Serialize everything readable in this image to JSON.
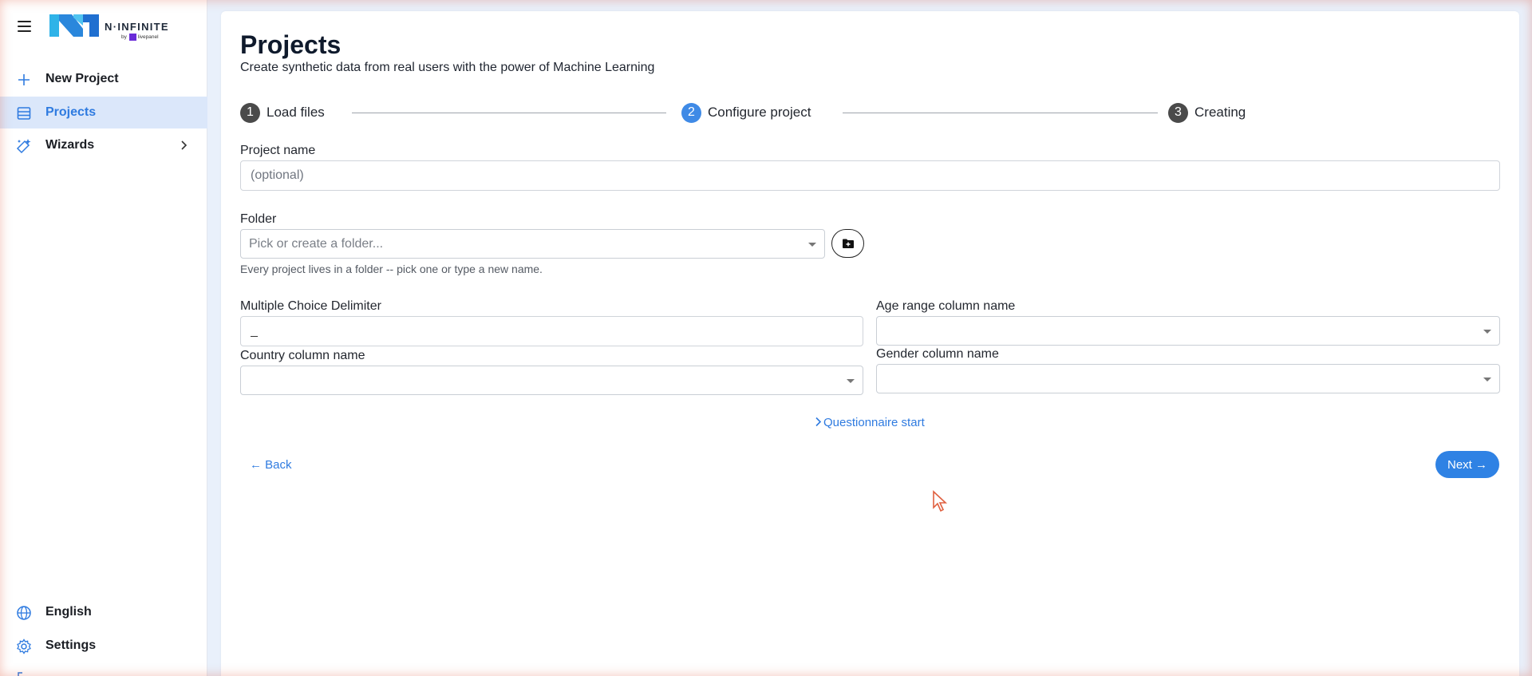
{
  "brand": {
    "name": "N·INFINITE",
    "by": "by",
    "partner": "livepanel"
  },
  "sidebar": {
    "items": [
      {
        "label": "New Project",
        "icon": "plus-icon"
      },
      {
        "label": "Projects",
        "icon": "list-icon",
        "active": true
      },
      {
        "label": "Wizards",
        "icon": "sparkle-icon",
        "has_submenu": true
      }
    ],
    "bottom_items": [
      {
        "label": "English",
        "icon": "globe-icon"
      },
      {
        "label": "Settings",
        "icon": "gear-icon"
      }
    ]
  },
  "page": {
    "title": "Projects",
    "subtitle": "Create synthetic data from real users with the power of Machine Learning"
  },
  "stepper": {
    "steps": [
      {
        "number": "1",
        "label": "Load files",
        "state": "done"
      },
      {
        "number": "2",
        "label": "Configure project",
        "state": "active"
      },
      {
        "number": "3",
        "label": "Creating",
        "state": "pending"
      }
    ]
  },
  "form": {
    "project_name": {
      "label": "Project name",
      "placeholder": "(optional)",
      "value": ""
    },
    "folder": {
      "label": "Folder",
      "placeholder": "Pick or create a folder...",
      "helper": "Every project lives in a folder -- pick one or type a new name."
    },
    "delimiter": {
      "label": "Multiple Choice Delimiter",
      "value": "_"
    },
    "age_range": {
      "label": "Age range column name",
      "value": ""
    },
    "country": {
      "label": "Country column name",
      "value": ""
    },
    "gender": {
      "label": "Gender column name",
      "value": ""
    },
    "questionnaire_start": "Questionnaire start"
  },
  "actions": {
    "back": "← Back",
    "next": "Next →"
  },
  "colors": {
    "accent": "#2f82e4",
    "active_nav_bg": "#dbe7fa",
    "step_inactive": "#4a4a4a"
  }
}
